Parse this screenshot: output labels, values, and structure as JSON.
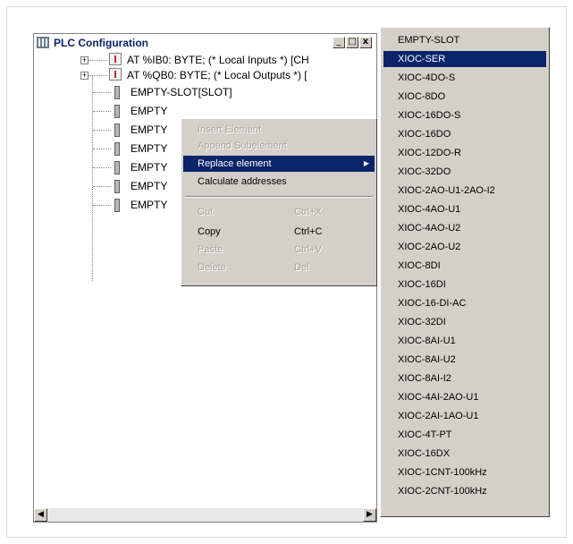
{
  "window": {
    "title": "PLC Configuration",
    "buttons": {
      "minimize": "_",
      "maximize": "□",
      "close": "x"
    }
  },
  "tree": {
    "nodes": [
      {
        "label": "AT %IB0: BYTE; (* Local Inputs *) [CH",
        "icon": "io-module-icon"
      },
      {
        "label": "AT %QB0: BYTE; (* Local Outputs *) [",
        "icon": "io-module-icon"
      },
      {
        "label": "EMPTY-SLOT[SLOT]",
        "icon": "slot-icon"
      },
      {
        "label": "EMPTY",
        "icon": "slot-icon"
      },
      {
        "label": "EMPTY",
        "icon": "slot-icon"
      },
      {
        "label": "EMPTY",
        "icon": "slot-icon"
      },
      {
        "label": "EMPTY",
        "icon": "slot-icon"
      },
      {
        "label": "EMPTY",
        "icon": "slot-icon"
      },
      {
        "label": "EMPTY",
        "icon": "slot-icon"
      }
    ]
  },
  "context_menu": {
    "items": [
      {
        "label": "Insert Element",
        "shortcut": "",
        "enabled": false
      },
      {
        "label": "Append Subelement",
        "shortcut": "",
        "enabled": false
      },
      {
        "label": "Replace element",
        "shortcut": "",
        "enabled": true,
        "highlighted": true,
        "submenu": true
      },
      {
        "label": "Calculate addresses",
        "shortcut": "",
        "enabled": true
      },
      {
        "label": "Cut",
        "shortcut": "Ctrl+X",
        "enabled": false
      },
      {
        "label": "Copy",
        "shortcut": "Ctrl+C",
        "enabled": true
      },
      {
        "label": "Paste",
        "shortcut": "Ctrl+V",
        "enabled": false
      },
      {
        "label": "Delete",
        "shortcut": "Del",
        "enabled": false
      }
    ]
  },
  "submenu": {
    "selected_index": 1,
    "items": [
      "EMPTY-SLOT",
      "XIOC-SER",
      "XIOC-4DO-S",
      "XIOC-8DO",
      "XIOC-16DO-S",
      "XIOC-16DO",
      "XIOC-12DO-R",
      "XIOC-32DO",
      "XIOC-2AO-U1-2AO-I2",
      "XIOC-4AO-U1",
      "XIOC-4AO-U2",
      "XIOC-2AO-U2",
      "XIOC-8DI",
      "XIOC-16DI",
      "XIOC-16-DI-AC",
      "XIOC-32DI",
      "XIOC-8AI-U1",
      "XIOC-8AI-U2",
      "XIOC-8AI-I2",
      "XIOC-4AI-2AO-U1",
      "XIOC-2AI-1AO-U1",
      "XIOC-4T-PT",
      "XIOC-16DX",
      "XIOC-1CNT-100kHz",
      "XIOC-2CNT-100kHz"
    ]
  },
  "colors": {
    "highlight": "#0a246a",
    "menu_bg": "#d4d0c8",
    "title_text": "#0a246a"
  }
}
